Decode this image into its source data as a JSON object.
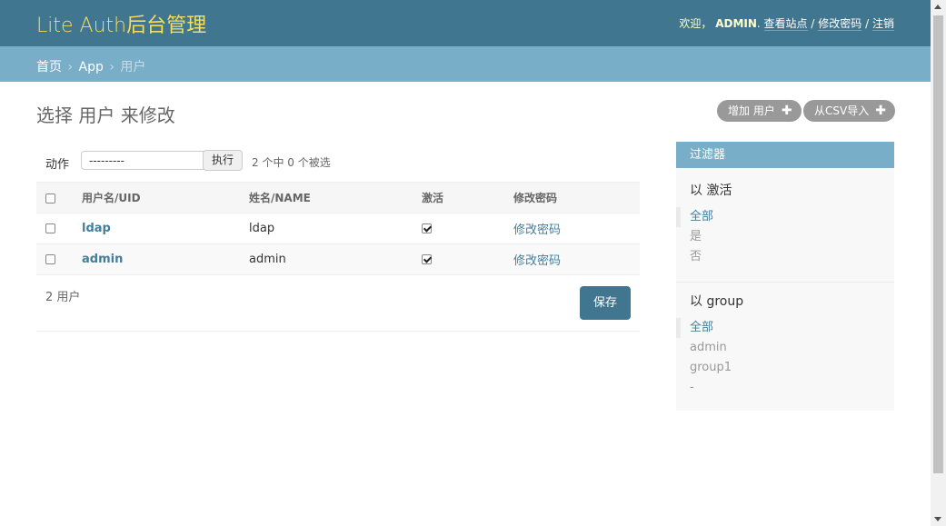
{
  "header": {
    "brand": "Lite Auth后台管理",
    "welcome": "欢迎，",
    "username": "ADMIN",
    "view_site": "查看站点",
    "change_password": "修改密码",
    "logout": "注销",
    "sep": "/"
  },
  "breadcrumbs": {
    "home": "首页",
    "app": "App",
    "current": "用户",
    "sep": "›"
  },
  "main": {
    "title": "选择 用户 来修改",
    "add_button": "增加 用户",
    "import_button": "从CSV导入"
  },
  "actions": {
    "label": "动作",
    "select_value": "---------",
    "go_label": "执行",
    "counter": "2 个中 0 个被选"
  },
  "table": {
    "headers": [
      "用户名/UID",
      "姓名/NAME",
      "激活",
      "修改密码"
    ],
    "rows": [
      {
        "username": "ldap",
        "name": "ldap",
        "active": true,
        "password_link": "修改密码"
      },
      {
        "username": "admin",
        "name": "admin",
        "active": true,
        "password_link": "修改密码"
      }
    ]
  },
  "footer": {
    "count": "2 用户",
    "save": "保存"
  },
  "filter": {
    "title": "过滤器",
    "groups": [
      {
        "title": "以 激活",
        "items": [
          "全部",
          "是",
          "否"
        ],
        "selected": 0
      },
      {
        "title": "以 group",
        "items": [
          "全部",
          "admin",
          "group1",
          "-"
        ],
        "selected": 0
      }
    ]
  },
  "colors": {
    "header_bg": "#417690",
    "brand": "#f5dd5d",
    "breadcrumb_bg": "#79aec8",
    "link": "#447e9b",
    "button_gray": "#999999"
  },
  "icons": {
    "add": "plus-icon",
    "dropdown": "caret-down-icon"
  }
}
